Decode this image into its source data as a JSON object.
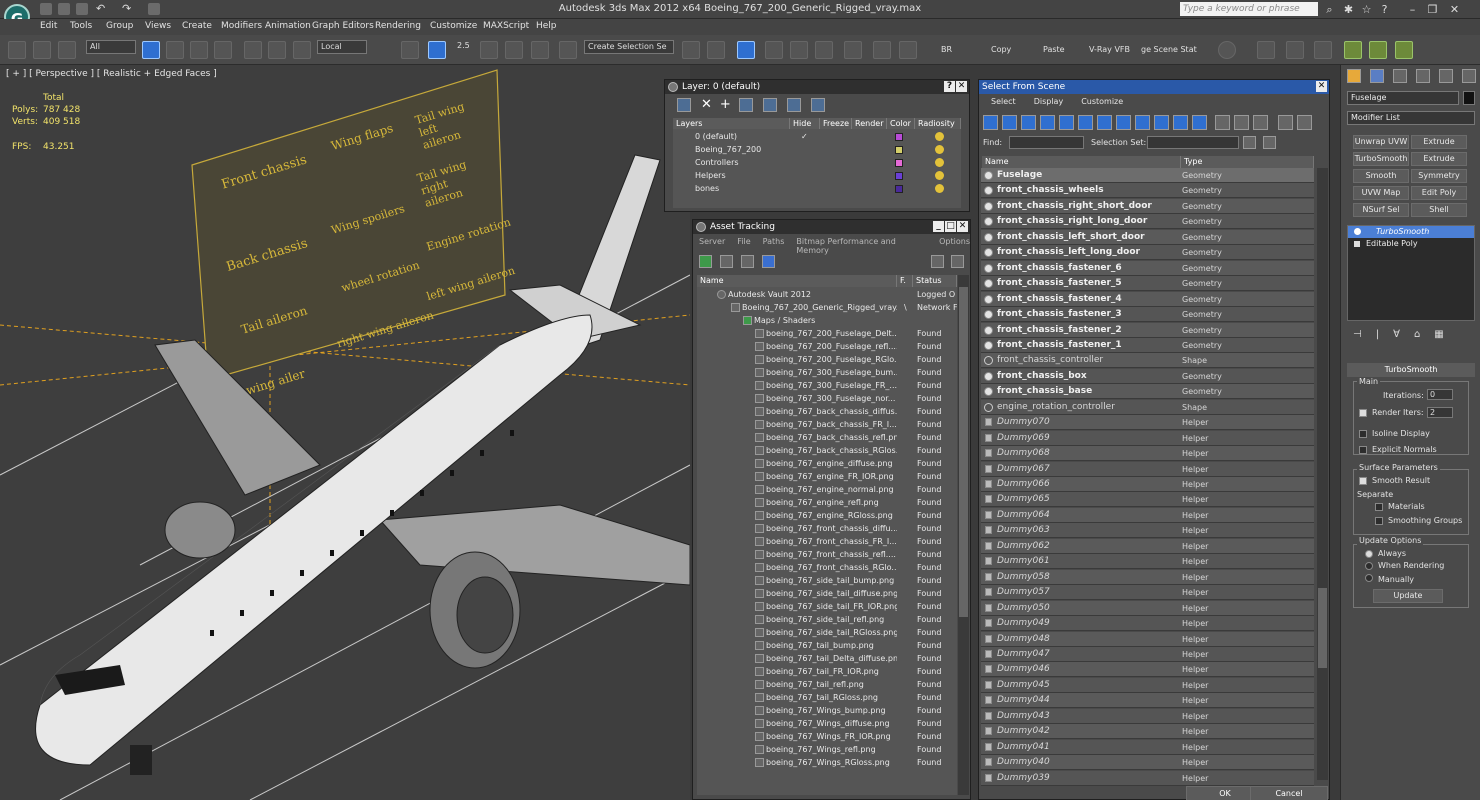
{
  "titlebar": {
    "title": "Autodesk 3ds Max  2012 x64     Boeing_767_200_Generic_Rigged_vray.max",
    "search_placeholder": "Type a keyword or phrase"
  },
  "menu": [
    "Edit",
    "Tools",
    "Group",
    "Views",
    "Create",
    "Modifiers",
    "Animation",
    "Graph Editors",
    "Rendering",
    "Customize",
    "MAXScript",
    "Help"
  ],
  "toolbar": {
    "filter": "All",
    "coord": "Local",
    "snap_angle": "2.5",
    "selection_set": "Create Selection Se",
    "br": "BR",
    "copy": "Copy",
    "paste": "Paste",
    "vray": "V-Ray VFB",
    "scene_state": "ge Scene Stat"
  },
  "viewport": {
    "label": "[ + ] [ Perspective ] [ Realistic + Edged Faces ]",
    "total_label": "Total",
    "polys_label": "Polys:",
    "polys": "787 428",
    "verts_label": "Verts:",
    "verts": "409 518",
    "fps_label": "FPS:",
    "fps": "43.251",
    "control_labels": [
      "Front chassis",
      "Wing flaps",
      "Tail wing left aileron",
      "Tail wing right aileron",
      "Back chassis",
      "Wing spoilers",
      "Engine rotation",
      "Tail aileron",
      "wheel rotation",
      "left wing aileron",
      "right wing aileron",
      "wing ailer"
    ]
  },
  "layer": {
    "title": "Layer: 0 (default)",
    "columns": [
      "Layers",
      "Hide",
      "Freeze",
      "Render",
      "Color",
      "Radiosity"
    ],
    "rows": [
      {
        "name": "0 (default)",
        "color": "#b84bd6",
        "hide": "✓"
      },
      {
        "name": "Boeing_767_200",
        "color": "#d4cf6a",
        "hide": ""
      },
      {
        "name": "Controllers",
        "color": "#e56ad6",
        "hide": ""
      },
      {
        "name": "Helpers",
        "color": "#6a3fd6",
        "hide": ""
      },
      {
        "name": "bones",
        "color": "#4a2a9a",
        "hide": ""
      }
    ]
  },
  "asset": {
    "title": "Asset Tracking",
    "menu": [
      "Server",
      "File",
      "Paths",
      "Bitmap Performance and Memory",
      "Options"
    ],
    "col_name": "Name",
    "col_f": "F.",
    "col_status": "Status",
    "vault": "Autodesk Vault 2012",
    "vault_status": "Logged O",
    "file": "Boeing_767_200_Generic_Rigged_vray....",
    "file_f": "\\",
    "file_status": "Network F",
    "maps": "Maps / Shaders",
    "items": [
      "boeing_767_200_Fuselage_Delt...",
      "boeing_767_200_Fuselage_refl....",
      "boeing_767_200_Fuselage_RGlo...",
      "boeing_767_300_Fuselage_bum...",
      "boeing_767_300_Fuselage_FR_...",
      "boeing_767_300_Fuselage_nor...",
      "boeing_767_back_chassis_diffus...",
      "boeing_767_back_chassis_FR_I...",
      "boeing_767_back_chassis_refl.png",
      "boeing_767_back_chassis_RGlos...",
      "boeing_767_engine_diffuse.png",
      "boeing_767_engine_FR_IOR.png",
      "boeing_767_engine_normal.png",
      "boeing_767_engine_refl.png",
      "boeing_767_engine_RGloss.png",
      "boeing_767_front_chassis_diffu...",
      "boeing_767_front_chassis_FR_I...",
      "boeing_767_front_chassis_refl....",
      "boeing_767_front_chassis_RGlo...",
      "boeing_767_side_tail_bump.png",
      "boeing_767_side_tail_diffuse.png",
      "boeing_767_side_tail_FR_IOR.png",
      "boeing_767_side_tail_refl.png",
      "boeing_767_side_tail_RGloss.png",
      "boeing_767_tail_bump.png",
      "boeing_767_tail_Delta_diffuse.png",
      "boeing_767_tail_FR_IOR.png",
      "boeing_767_tail_refl.png",
      "boeing_767_tail_RGloss.png",
      "boeing_767_Wings_bump.png",
      "boeing_767_Wings_diffuse.png",
      "boeing_767_Wings_FR_IOR.png",
      "boeing_767_Wings_refl.png",
      "boeing_767_Wings_RGloss.png"
    ],
    "found": "Found"
  },
  "select": {
    "title": "Select From Scene",
    "menu": [
      "Select",
      "Display",
      "Customize"
    ],
    "find_label": "Find:",
    "selset_label": "Selection Set:",
    "col_name": "Name",
    "col_type": "Type",
    "ok": "OK",
    "cancel": "Cancel",
    "rows": [
      {
        "name": "Fuselage",
        "type": "Geometry",
        "kind": "geo",
        "selected": true
      },
      {
        "name": "front_chassis_wheels",
        "type": "Geometry",
        "kind": "geo"
      },
      {
        "name": "front_chassis_right_short_door",
        "type": "Geometry",
        "kind": "geo"
      },
      {
        "name": "front_chassis_right_long_door",
        "type": "Geometry",
        "kind": "geo"
      },
      {
        "name": "front_chassis_left_short_door",
        "type": "Geometry",
        "kind": "geo"
      },
      {
        "name": "front_chassis_left_long_door",
        "type": "Geometry",
        "kind": "geo"
      },
      {
        "name": "front_chassis_fastener_6",
        "type": "Geometry",
        "kind": "geo"
      },
      {
        "name": "front_chassis_fastener_5",
        "type": "Geometry",
        "kind": "geo"
      },
      {
        "name": "front_chassis_fastener_4",
        "type": "Geometry",
        "kind": "geo"
      },
      {
        "name": "front_chassis_fastener_3",
        "type": "Geometry",
        "kind": "geo"
      },
      {
        "name": "front_chassis_fastener_2",
        "type": "Geometry",
        "kind": "geo"
      },
      {
        "name": "front_chassis_fastener_1",
        "type": "Geometry",
        "kind": "geo"
      },
      {
        "name": "front_chassis_controller",
        "type": "Shape",
        "kind": "shape"
      },
      {
        "name": "front_chassis_box",
        "type": "Geometry",
        "kind": "geo"
      },
      {
        "name": "front_chassis_base",
        "type": "Geometry",
        "kind": "geo"
      },
      {
        "name": "engine_rotation_controller",
        "type": "Shape",
        "kind": "shape"
      },
      {
        "name": "Dummy070",
        "type": "Helper",
        "kind": "helper"
      },
      {
        "name": "Dummy069",
        "type": "Helper",
        "kind": "helper"
      },
      {
        "name": "Dummy068",
        "type": "Helper",
        "kind": "helper"
      },
      {
        "name": "Dummy067",
        "type": "Helper",
        "kind": "helper"
      },
      {
        "name": "Dummy066",
        "type": "Helper",
        "kind": "helper"
      },
      {
        "name": "Dummy065",
        "type": "Helper",
        "kind": "helper"
      },
      {
        "name": "Dummy064",
        "type": "Helper",
        "kind": "helper"
      },
      {
        "name": "Dummy063",
        "type": "Helper",
        "kind": "helper"
      },
      {
        "name": "Dummy062",
        "type": "Helper",
        "kind": "helper"
      },
      {
        "name": "Dummy061",
        "type": "Helper",
        "kind": "helper"
      },
      {
        "name": "Dummy058",
        "type": "Helper",
        "kind": "helper"
      },
      {
        "name": "Dummy057",
        "type": "Helper",
        "kind": "helper"
      },
      {
        "name": "Dummy050",
        "type": "Helper",
        "kind": "helper"
      },
      {
        "name": "Dummy049",
        "type": "Helper",
        "kind": "helper"
      },
      {
        "name": "Dummy048",
        "type": "Helper",
        "kind": "helper"
      },
      {
        "name": "Dummy047",
        "type": "Helper",
        "kind": "helper"
      },
      {
        "name": "Dummy046",
        "type": "Helper",
        "kind": "helper"
      },
      {
        "name": "Dummy045",
        "type": "Helper",
        "kind": "helper"
      },
      {
        "name": "Dummy044",
        "type": "Helper",
        "kind": "helper"
      },
      {
        "name": "Dummy043",
        "type": "Helper",
        "kind": "helper"
      },
      {
        "name": "Dummy042",
        "type": "Helper",
        "kind": "helper"
      },
      {
        "name": "Dummy041",
        "type": "Helper",
        "kind": "helper"
      },
      {
        "name": "Dummy040",
        "type": "Helper",
        "kind": "helper"
      },
      {
        "name": "Dummy039",
        "type": "Helper",
        "kind": "helper"
      }
    ]
  },
  "command": {
    "object_name": "Fuselage",
    "modifier_list": "Modifier List",
    "buttons": [
      "Unwrap UVW",
      "Extrude",
      "TurboSmooth",
      "Extrude",
      "Smooth",
      "Symmetry",
      "UVW Map",
      "Edit Poly",
      "NSurf Sel",
      "Shell"
    ],
    "stack": [
      "TurboSmooth",
      "Editable Poly"
    ],
    "rollout_title": "TurboSmooth",
    "main_label": "Main",
    "iterations_label": "Iterations:",
    "iterations": "0",
    "render_iters_label": "Render Iters:",
    "render_iters": "2",
    "isoline": "Isoline Display",
    "explicit_normals": "Explicit Normals",
    "surface_params": "Surface Parameters",
    "smooth_result": "Smooth Result",
    "separate": "Separate",
    "materials": "Materials",
    "smoothing_groups": "Smoothing Groups",
    "update_options": "Update Options",
    "always": "Always",
    "when_rendering": "When Rendering",
    "manually": "Manually",
    "update": "Update"
  }
}
